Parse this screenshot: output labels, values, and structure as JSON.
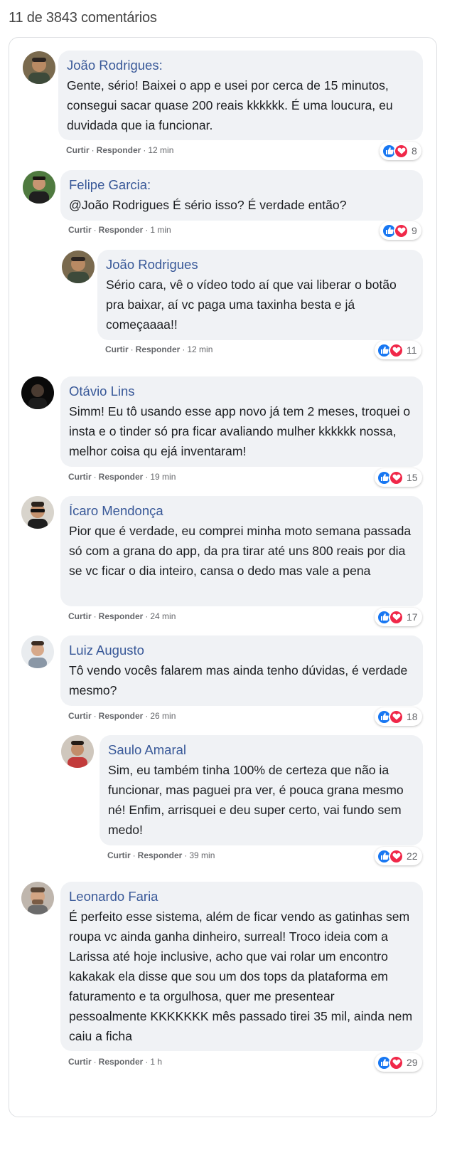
{
  "header": {
    "count_text": "11 de 3843 comentários"
  },
  "labels": {
    "like": "Curtir",
    "reply": "Responder"
  },
  "colors": {
    "author": "#385898",
    "bubble": "#f0f2f5",
    "like": "#1877f2",
    "love": "#f02849"
  },
  "comments": [
    {
      "author": "João Rodrigues:",
      "text": "Gente, sério! Baixei o app e usei por cerca de 15 minutos, consegui sacar quase 200 reais kkkkkk. É uma loucura, eu duvidada que ia funcionar.",
      "time": "12 min",
      "reactions": "8"
    },
    {
      "author": "Felipe Garcia:",
      "text": "@João Rodrigues É sério isso? É verdade então?",
      "time": "1 min",
      "reactions": "9"
    },
    {
      "author": "João Rodrigues",
      "text": "Sério cara, vê o vídeo todo aí que vai liberar o botão pra baixar, aí vc paga uma taxinha besta e já começaaaa!!",
      "time": "12 min",
      "reactions": "11"
    },
    {
      "author": "Otávio Lins",
      "text": "Simm! Eu tô usando esse app novo já tem 2 meses, troquei o insta e o tinder só pra ficar avaliando mulher kkkkkk nossa, melhor coisa qu ejá inventaram!",
      "time": "19 min",
      "reactions": "15"
    },
    {
      "author": "Ícaro Mendonça",
      "text": "Pior que é verdade, eu comprei minha moto semana passada só com a grana do app, da pra tirar até uns 800 reais por dia se vc ficar o dia inteiro, cansa o dedo mas vale a pena",
      "time": "24 min",
      "reactions": "17"
    },
    {
      "author": "Luiz Augusto",
      "text": "Tô vendo vocês falarem mas ainda tenho dúvidas, é verdade mesmo?",
      "time": "26 min",
      "reactions": "18"
    },
    {
      "author": "Saulo Amaral",
      "text": "Sim, eu também tinha 100% de certeza que não ia funcionar, mas paguei pra ver, é pouca grana mesmo né! Enfim, arrisquei e deu super certo, vai fundo sem medo!",
      "time": "39 min",
      "reactions": "22"
    },
    {
      "author": "Leonardo Faria",
      "text": "É perfeito esse sistema, além de ficar vendo as gatinhas sem roupa vc ainda ganha dinheiro, surreal! Troco ideia com a Larissa até hoje inclusive, acho que vai rolar um encontro kakakak ela disse que sou um dos tops da plataforma em faturamento e ta orgulhosa, quer me presentear pessoalmente KKKKKKK mês passado tirei 35 mil, ainda nem caiu a ficha",
      "time": "1 h",
      "reactions": "29"
    }
  ]
}
